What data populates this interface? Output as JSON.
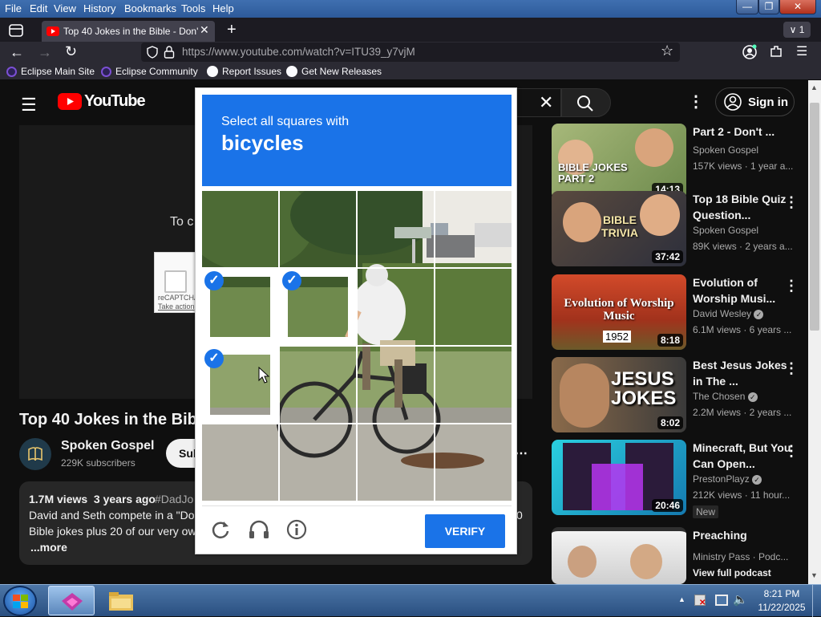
{
  "menu": [
    "File",
    "Edit",
    "View",
    "History",
    "Bookmarks",
    "Tools",
    "Help"
  ],
  "tab": {
    "title": "Top 40 Jokes in the Bible - Don't",
    "tab_count": "1"
  },
  "url": "https://www.youtube.com/watch?v=ITU39_y7vjM",
  "bookmarks": [
    "Eclipse Main Site",
    "Eclipse Community",
    "Report Issues",
    "Get New Releases"
  ],
  "youtube": {
    "logo_text": "YouTube",
    "sign_in": "Sign in",
    "player_text": "To c",
    "recaptcha_label": "reCAPTCHA",
    "recaptcha_action": "Take action",
    "video_title": "Top 40 Jokes in the Bible",
    "channel": "Spoken Gospel",
    "subscribers": "229K subscribers",
    "subscribe_btn": "Sub",
    "desc_stats": "1.7M views  3 years ago",
    "desc_tag": "#DadJo",
    "desc_line1": "David and Seth compete in a \"Don",
    "desc_line2": "Bible jokes plus 20 of our very ow",
    "desc_more": "...more",
    "desc_side_digit": "0"
  },
  "recommendations": [
    {
      "title": "Part 2 - Don't ...",
      "channel": "Spoken Gospel",
      "meta": "157K views · 1 year a...",
      "duration": "14:13",
      "thumb_text": "BIBLE JOKES PART 2",
      "badge": "",
      "verified": false
    },
    {
      "title": "Top 18 Bible Quiz Question...",
      "channel": "Spoken Gospel",
      "meta": "89K views · 2 years a...",
      "duration": "37:42",
      "thumb_text": "BIBLE TRIVIA",
      "badge": "",
      "verified": false
    },
    {
      "title": "Evolution of Worship Musi...",
      "channel": "David Wesley",
      "meta": "6.1M views · 6 years ...",
      "duration": "8:18",
      "thumb_text": "Evolution of Worship Music",
      "thumb_year": "1952",
      "badge": "",
      "verified": true
    },
    {
      "title": "Best Jesus Jokes in The ...",
      "channel": "The Chosen",
      "meta": "2.2M views · 2 years ...",
      "duration": "8:02",
      "thumb_text": "JESUS JOKES",
      "badge": "",
      "verified": true
    },
    {
      "title": "Minecraft, But You Can Open...",
      "channel": "PrestonPlayz",
      "meta": "212K views · 11 hour...",
      "duration": "20:46",
      "thumb_text": "",
      "badge": "New",
      "verified": true
    },
    {
      "title": "Preaching",
      "channel": "Ministry Pass · Podc...",
      "meta": "View full podcast",
      "duration": "",
      "thumb_text": "",
      "badge": "",
      "verified": false
    }
  ],
  "captcha": {
    "instruction": "Select all squares with",
    "target": "bicycles",
    "verify": "VERIFY",
    "selected_cells": [
      4,
      5,
      8
    ]
  },
  "taskbar": {
    "time": "8:21 PM",
    "date": "11/22/2025"
  }
}
